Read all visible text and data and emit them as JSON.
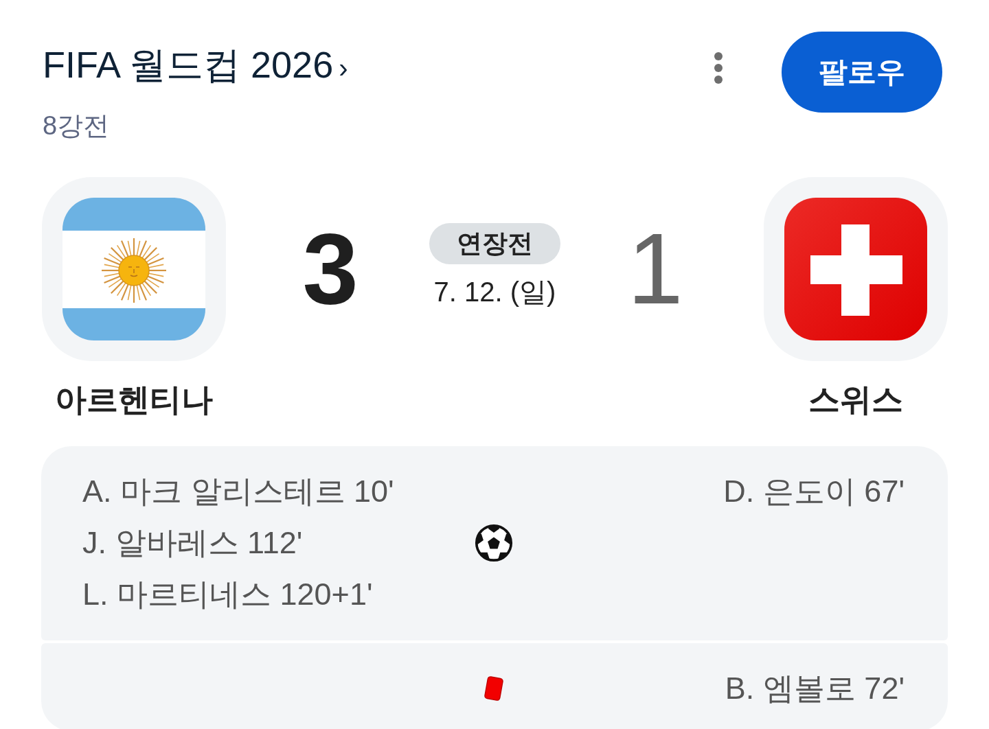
{
  "header": {
    "competition": "FIFA 월드컵 2026",
    "chevron": "›",
    "stage": "8강전",
    "follow_button": "팔로우"
  },
  "match": {
    "home": {
      "name": "아르헨티나",
      "score": "3",
      "winner": true
    },
    "status_badge": "연장전",
    "date": "7. 12. (일)",
    "away": {
      "name": "스위스",
      "score": "1",
      "winner": false
    }
  },
  "events": [
    {
      "kind": "goal",
      "home": [
        "A. 마크 알리스테르 10'",
        "J. 알바레스 112'",
        "L. 마르티네스 120+1'"
      ],
      "away": [
        "D. 은도이 67'"
      ]
    },
    {
      "kind": "red_card",
      "away": [
        "B. 엠볼로 72'"
      ]
    }
  ]
}
